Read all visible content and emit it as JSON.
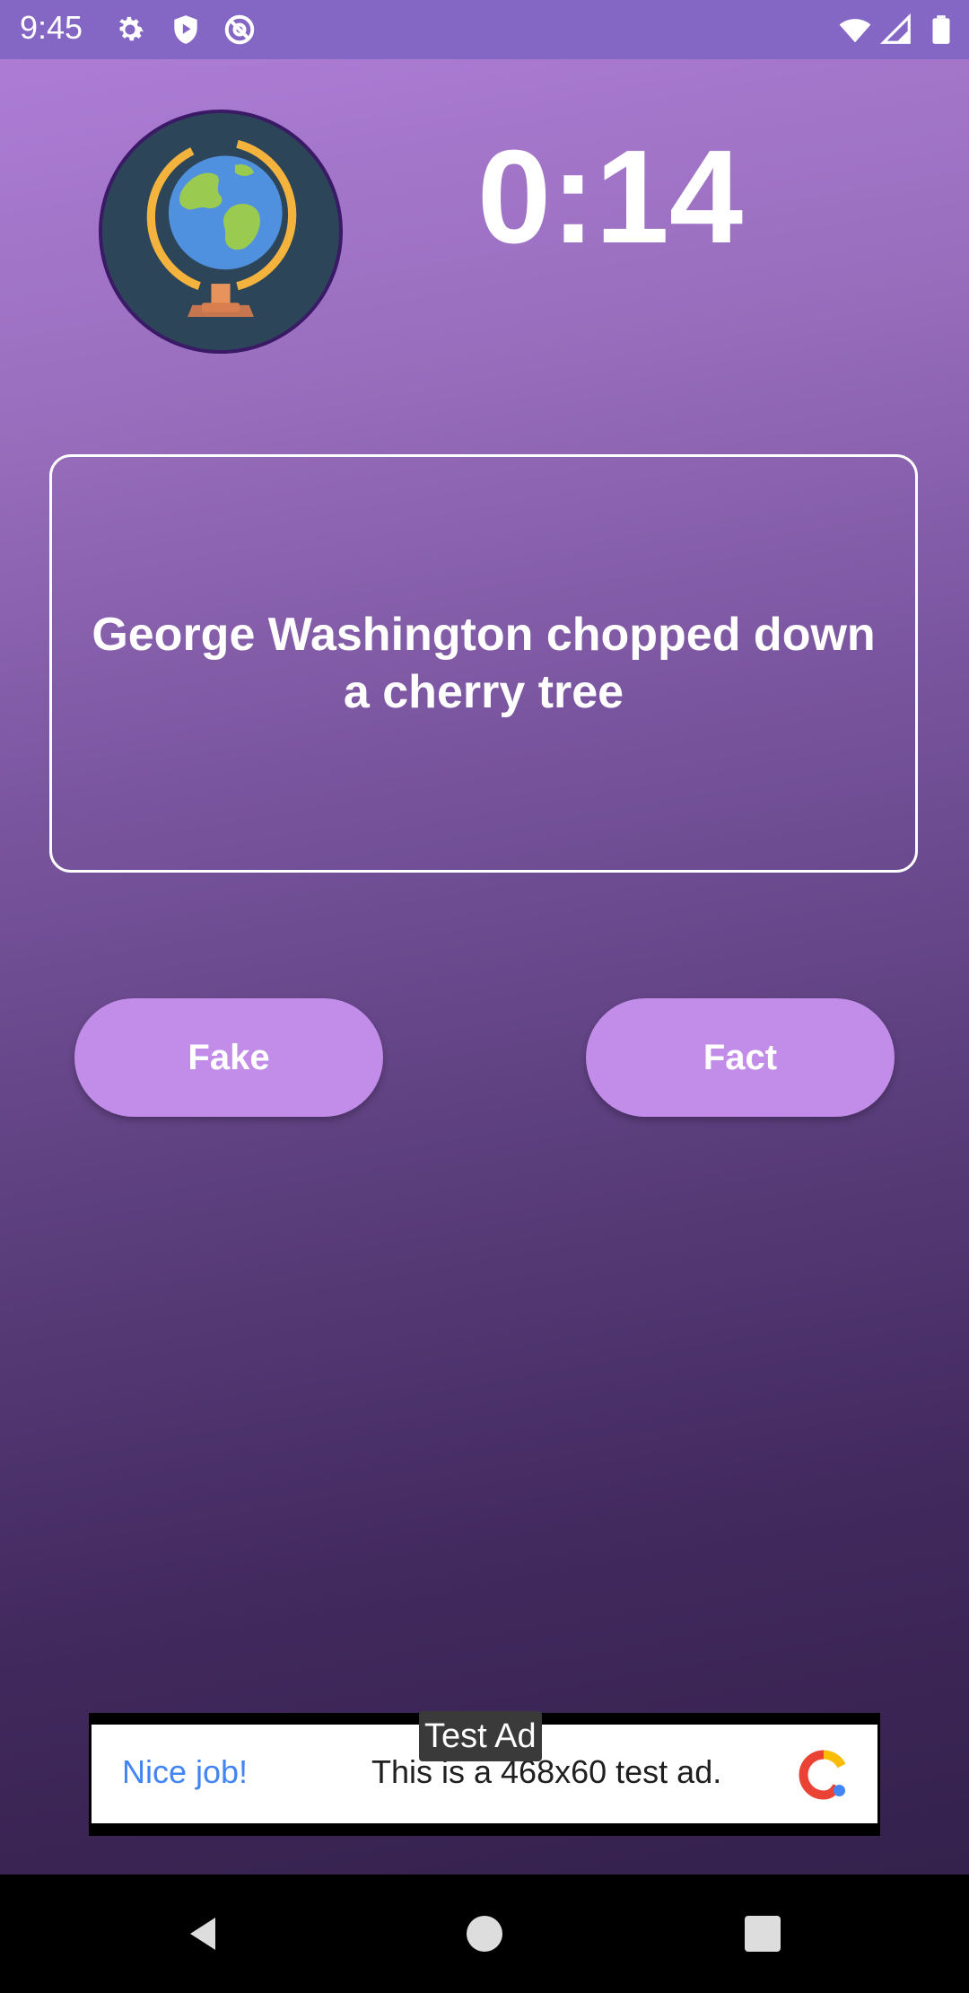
{
  "status_bar": {
    "time": "9:45",
    "icons": [
      "settings-icon",
      "shield-play-icon",
      "at-sign-icon",
      "wifi-icon",
      "signal-icon",
      "battery-icon"
    ]
  },
  "game": {
    "logo": "globe-icon",
    "timer": "0:14",
    "question": "George Washington chopped down a cherry tree",
    "buttons": {
      "fake_label": "Fake",
      "fact_label": "Fact"
    }
  },
  "ad": {
    "label": "Test Ad",
    "headline": "Nice job!",
    "body": "This is a 468x60 test ad.",
    "logo": "ad-logo-icon"
  },
  "nav": {
    "icons": [
      "back-icon",
      "home-icon",
      "recents-icon"
    ]
  },
  "colors": {
    "status_bar": "#8466c5",
    "button": "#c28ce9",
    "ad_headline": "#4285f4"
  }
}
